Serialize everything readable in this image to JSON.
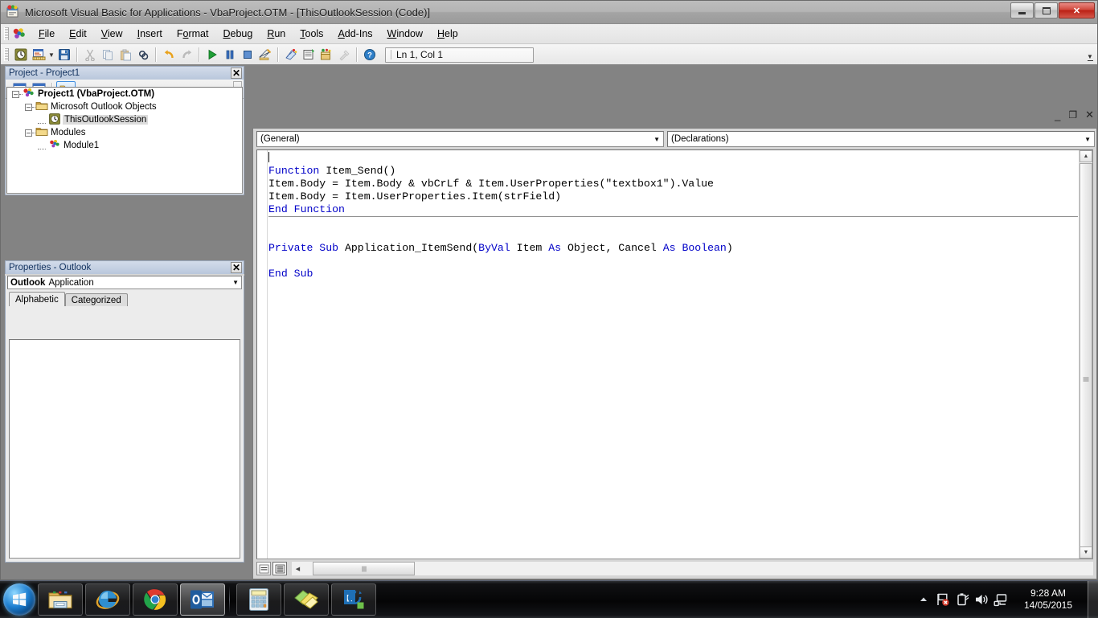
{
  "window": {
    "title": "Microsoft Visual Basic for Applications - VbaProject.OTM - [ThisOutlookSession (Code)]",
    "icon": "vba-window-icon",
    "minimize_label": "",
    "maximize_label": "",
    "close_label": "✕"
  },
  "menubar": {
    "items": [
      {
        "label": "File",
        "accel": "F"
      },
      {
        "label": "Edit",
        "accel": "E"
      },
      {
        "label": "View",
        "accel": "V"
      },
      {
        "label": "Insert",
        "accel": "I"
      },
      {
        "label": "Format",
        "accel": "o"
      },
      {
        "label": "Debug",
        "accel": "D"
      },
      {
        "label": "Run",
        "accel": "R"
      },
      {
        "label": "Tools",
        "accel": "T"
      },
      {
        "label": "Add-Ins",
        "accel": "A"
      },
      {
        "label": "Window",
        "accel": "W"
      },
      {
        "label": "Help",
        "accel": "H"
      }
    ]
  },
  "toolbar": {
    "buttons": [
      {
        "name": "view-outlook-button",
        "tip": "View Microsoft Outlook"
      },
      {
        "name": "insert-userform-button",
        "tip": "Insert UserForm"
      },
      {
        "name": "save-button",
        "tip": "Save VbaProject.OTM"
      },
      {
        "name": "cut-button",
        "tip": "Cut"
      },
      {
        "name": "copy-button",
        "tip": "Copy"
      },
      {
        "name": "paste-button",
        "tip": "Paste"
      },
      {
        "name": "find-button",
        "tip": "Find"
      },
      {
        "name": "undo-button",
        "tip": "Undo"
      },
      {
        "name": "redo-button",
        "tip": "Redo"
      },
      {
        "name": "run-button",
        "tip": "Run Sub/UserForm"
      },
      {
        "name": "break-button",
        "tip": "Break"
      },
      {
        "name": "reset-button",
        "tip": "Reset"
      },
      {
        "name": "design-mode-button",
        "tip": "Design Mode"
      },
      {
        "name": "project-explorer-button",
        "tip": "Project Explorer"
      },
      {
        "name": "properties-window-button",
        "tip": "Properties Window"
      },
      {
        "name": "object-browser-button",
        "tip": "Object Browser"
      },
      {
        "name": "toolbox-button",
        "tip": "Toolbox"
      },
      {
        "name": "help-button",
        "tip": "Microsoft Visual Basic for Applications Help"
      }
    ],
    "position_indicator": "Ln 1, Col 1"
  },
  "project_explorer": {
    "title": "Project - Project1",
    "close_label": "✕",
    "buttons": [
      {
        "name": "view-code-button",
        "tip": "View Code"
      },
      {
        "name": "view-object-button",
        "tip": "View Object"
      },
      {
        "name": "toggle-folders-button",
        "tip": "Toggle Folders",
        "active": true
      }
    ],
    "tree": [
      {
        "label": "Project1 (VbaProject.OTM)",
        "level": 0,
        "bold": true,
        "icon": "project-icon",
        "expander": "-"
      },
      {
        "label": "Microsoft Outlook Objects",
        "level": 1,
        "bold": false,
        "icon": "folder-icon",
        "expander": "-"
      },
      {
        "label": "ThisOutlookSession",
        "level": 2,
        "bold": false,
        "icon": "outlook-session-icon",
        "expander": "",
        "selected": true
      },
      {
        "label": "Modules",
        "level": 1,
        "bold": false,
        "icon": "folder-icon",
        "expander": "-"
      },
      {
        "label": "Module1",
        "level": 2,
        "bold": false,
        "icon": "module-icon",
        "expander": ""
      }
    ]
  },
  "properties_window": {
    "title": "Properties - Outlook",
    "close_label": "✕",
    "object_name": "Outlook",
    "object_type": "Application",
    "tabs": [
      {
        "label": "Alphabetic",
        "active": true
      },
      {
        "label": "Categorized",
        "active": false
      }
    ],
    "rows": []
  },
  "code_window": {
    "mdi_minimize": "_",
    "mdi_restore": "❐",
    "mdi_close": "✕",
    "object_combo": "(General)",
    "procedure_combo": "(Declarations)",
    "caret_line": "",
    "lines": [
      {
        "tokens": [
          {
            "t": "",
            "kw": false
          }
        ],
        "caret": true
      },
      {
        "tokens": [
          {
            "t": "Function",
            "kw": true
          },
          {
            "t": " Item_Send()",
            "kw": false
          }
        ]
      },
      {
        "tokens": [
          {
            "t": "Item.Body = Item.Body & vbCrLf & Item.UserProperties(\"textbox1\").Value",
            "kw": false
          }
        ]
      },
      {
        "tokens": [
          {
            "t": "Item.Body = Item.UserProperties.Item(strField)",
            "kw": false
          }
        ]
      },
      {
        "tokens": [
          {
            "t": "End Function",
            "kw": true
          }
        ]
      },
      {
        "separator": true
      },
      {
        "tokens": [
          {
            "t": "",
            "kw": false
          }
        ]
      },
      {
        "tokens": [
          {
            "t": "Private Sub ",
            "kw": true
          },
          {
            "t": "Application_ItemSend(",
            "kw": false
          },
          {
            "t": "ByVal ",
            "kw": true
          },
          {
            "t": "Item ",
            "kw": false
          },
          {
            "t": "As ",
            "kw": true
          },
          {
            "t": "Object",
            "kw": false
          },
          {
            "t": ", Cancel ",
            "kw": false
          },
          {
            "t": "As Boolean",
            "kw": true
          },
          {
            "t": ")",
            "kw": false
          }
        ]
      },
      {
        "tokens": [
          {
            "t": "",
            "kw": false
          }
        ]
      },
      {
        "tokens": [
          {
            "t": "End Sub",
            "kw": true
          }
        ]
      }
    ],
    "view_buttons": [
      {
        "name": "procedure-view-button",
        "tip": "Procedure View",
        "active": false
      },
      {
        "name": "full-module-view-button",
        "tip": "Full Module View",
        "active": true
      }
    ]
  },
  "taskbar": {
    "start_tip": "Start",
    "items": [
      {
        "name": "taskbar-windows-explorer",
        "label": "Windows Explorer",
        "state": "pinned"
      },
      {
        "name": "taskbar-internet-explorer",
        "label": "Internet Explorer",
        "state": "pinned"
      },
      {
        "name": "taskbar-google-chrome",
        "label": "Google Chrome",
        "state": "running"
      },
      {
        "name": "taskbar-microsoft-outlook",
        "label": "Microsoft Outlook",
        "state": "active"
      },
      {
        "name": "taskbar-calculator",
        "label": "Calculator",
        "state": "running"
      },
      {
        "name": "taskbar-sticky-notes",
        "label": "Sticky Notes",
        "state": "running"
      },
      {
        "name": "taskbar-lync",
        "label": "Microsoft Lync",
        "state": "running"
      }
    ],
    "tray": [
      {
        "name": "show-hidden-icons-button",
        "label": "▲"
      },
      {
        "name": "action-center-icon",
        "label": "Action Center"
      },
      {
        "name": "power-icon",
        "label": "Power"
      },
      {
        "name": "volume-icon",
        "label": "Volume"
      },
      {
        "name": "network-icon",
        "label": "Network"
      }
    ],
    "clock": {
      "time": "9:28 AM",
      "date": "14/05/2015"
    }
  },
  "colors": {
    "keyword_blue": "#0000c8",
    "pane_title_blue": "#11315e",
    "close_red": "#bb2015",
    "selection_gray": "#dcdcdc"
  }
}
